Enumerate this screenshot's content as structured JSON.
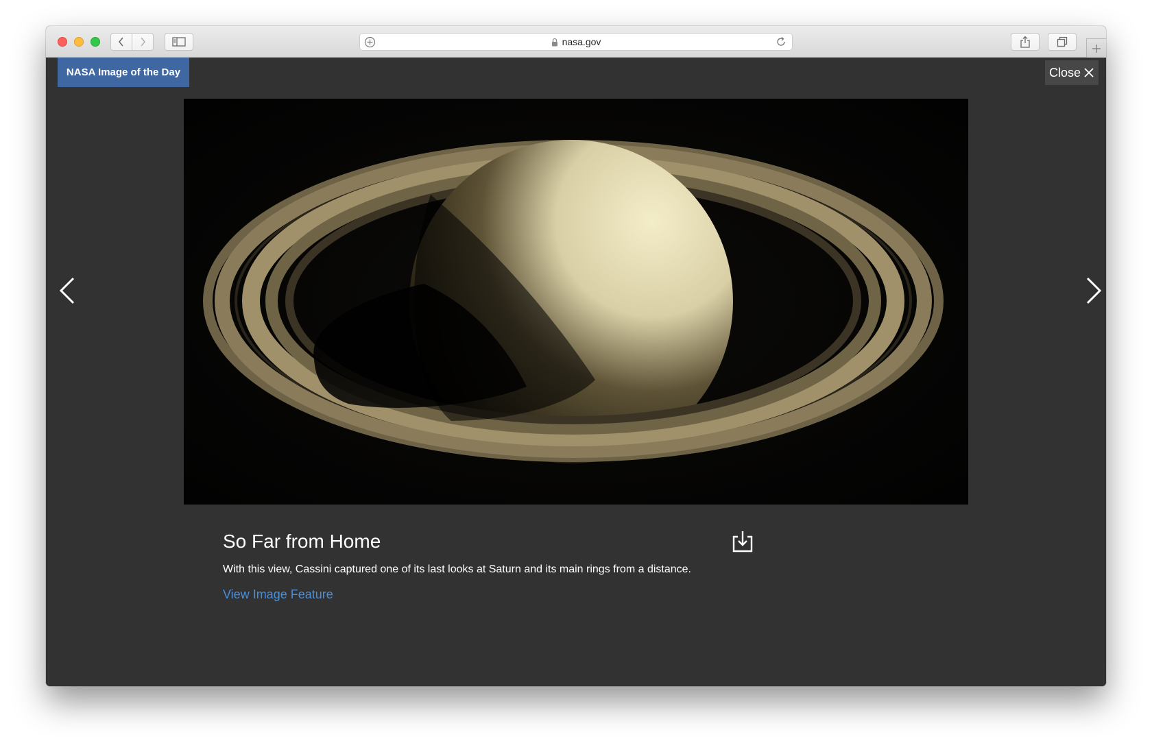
{
  "browser": {
    "url": "nasa.gov",
    "icons": {
      "back": "chevron-left-icon",
      "forward": "chevron-right-icon",
      "sidebar": "sidebar-icon",
      "share": "share-icon",
      "tabs": "tabs-icon",
      "new_tab": "plus-icon",
      "reader": "plus-circle-icon",
      "lock": "lock-icon",
      "reload": "reload-icon"
    }
  },
  "gallery": {
    "header_label": "NASA Image of the Day",
    "close_label": "Close",
    "title": "So Far from Home",
    "description": "With this view, Cassini captured one of its last looks at Saturn and its main rings from a distance.",
    "link_label": "View Image Feature",
    "icons": {
      "close": "close-icon",
      "previous": "chevron-left-icon",
      "next": "chevron-right-icon",
      "download": "download-icon"
    }
  },
  "colors": {
    "overlay_background": "#323232",
    "header_badge": "#3f68a2",
    "link": "#4a8fd8",
    "close_button": "#474747"
  }
}
